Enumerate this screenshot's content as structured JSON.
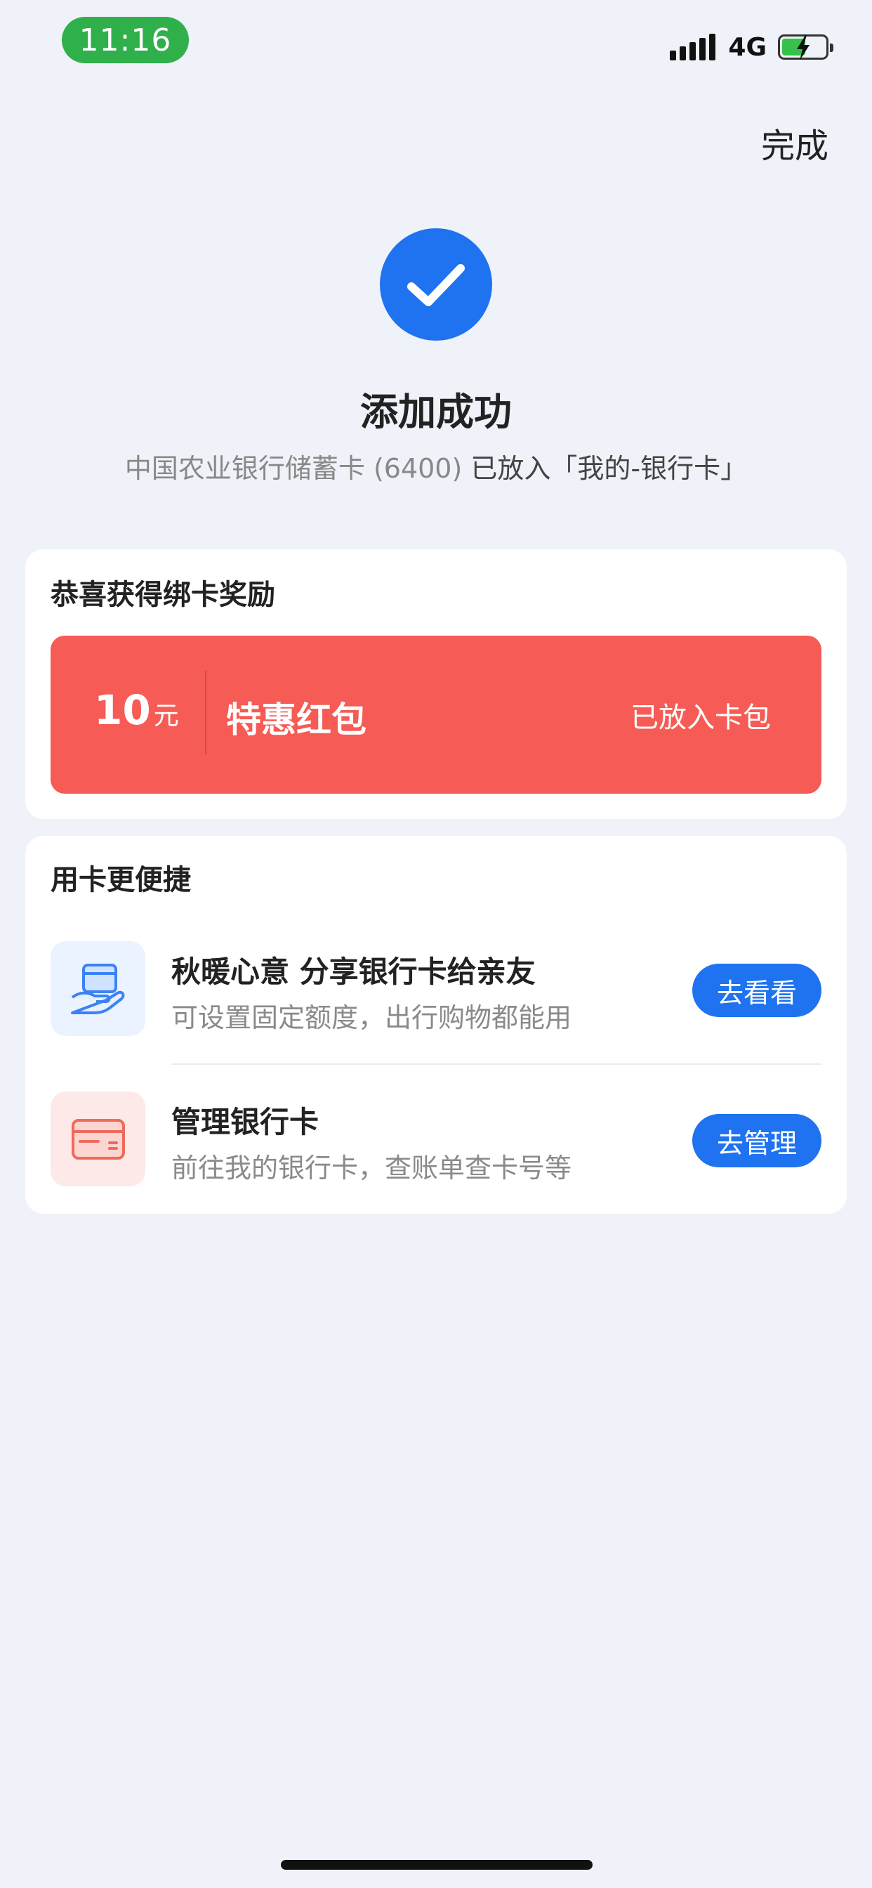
{
  "status_bar": {
    "time": "11:16",
    "network": "4G"
  },
  "header": {
    "done_label": "完成"
  },
  "success": {
    "title": "添加成功",
    "card_info": "中国农业银行储蓄卡 (6400)",
    "placed_text": "已放入「我的-银行卡」"
  },
  "reward_card": {
    "title": "恭喜获得绑卡奖励",
    "amount": "10",
    "unit": "元",
    "name": "特惠红包",
    "status": "已放入卡包"
  },
  "convenience_card": {
    "title": "用卡更便捷",
    "items": [
      {
        "title": "秋暖心意 分享银行卡给亲友",
        "desc": "可设置固定额度，出行购物都能用",
        "button": "去看看",
        "icon": "share-card-hand-icon"
      },
      {
        "title": "管理银行卡",
        "desc": "前往我的银行卡，查账单查卡号等",
        "button": "去管理",
        "icon": "bank-card-icon"
      }
    ]
  },
  "colors": {
    "accent": "#1f73f0",
    "reward": "#f65b55",
    "time_pill": "#2fb04b",
    "background": "#eff2f8"
  }
}
